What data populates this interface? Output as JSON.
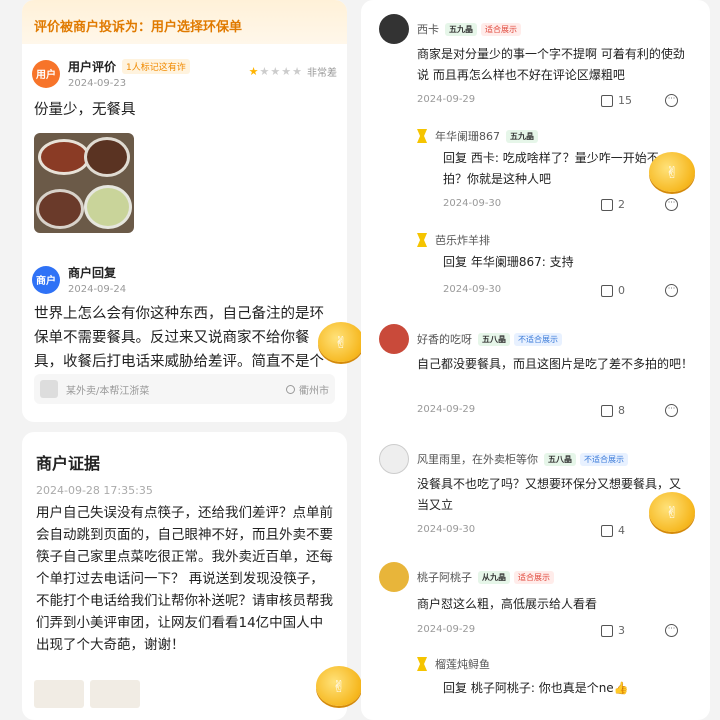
{
  "left": {
    "banner": "评价被商户投诉为：用户选择环保单",
    "review": {
      "avatar_text": "用户",
      "title": "用户评价",
      "tag": "1人标记这有诈",
      "date": "2024-09-23",
      "rating_label": "非常差",
      "stars": 1,
      "text": "份量少，无餐具"
    },
    "reply": {
      "avatar_text": "商户",
      "title": "商户回复",
      "date": "2024-09-24",
      "text": "世界上怎么会有你这种东西，自己备注的是环保单不需要餐具。反过来又说商家不给你餐具，收餐后打电话来威胁给差评。简直不是个人"
    },
    "shop": {
      "name": "某外卖/本帮江浙菜",
      "location": "衢州市"
    },
    "evidence": {
      "title": "商户证据",
      "timestamp": "2024-09-28 17:35:35",
      "text": "用户自己失误没有点筷子，还给我们差评？点单前会自动跳到页面的，自己眼神不好，而且外卖不要筷子自己家里点菜吃很正常。我外卖近百单，还每个单打过去电话问一下？ 再说送到发现没筷子，不能打个电话给我们让帮你补送呢？请审核员帮我们弄到小美评审团，让网友们看看14亿中国人中出现了个大奇葩，谢谢！"
    }
  },
  "comments": [
    {
      "name": "西卡",
      "level": "五九晶",
      "badge": "适合展示",
      "badge_kind": "r",
      "text": "商家是对分量少的事一个字不提啊 可着有利的使劲说 而且再怎么样也不好在评论区爆粗吧",
      "date": "2024-09-29",
      "likes": "15"
    },
    {
      "name": "年华阑珊867",
      "level": "五九晶",
      "badge": "",
      "badge_kind": "",
      "text": "回复  西卡: 吃成啥样了？量少咋一开始不拍？你就是这种人吧",
      "date": "2024-09-30",
      "likes": "2"
    },
    {
      "name": "芭乐炸羊排",
      "level": "",
      "badge": "",
      "badge_kind": "",
      "text": "回复  年华阑珊867: 支持",
      "date": "2024-09-30",
      "likes": "0"
    },
    {
      "name": "好香的吃呀",
      "level": "五八晶",
      "badge": "不适合展示",
      "badge_kind": "b",
      "text": "自己都没要餐具，而且这图片是吃了差不多拍的吧！",
      "date": "2024-09-29",
      "likes": "8"
    },
    {
      "name": "风里雨里，在外卖柜等你",
      "level": "五八晶",
      "badge": "不适合展示",
      "badge_kind": "b",
      "text": "没餐具不也吃了吗？又想要环保分又想要餐具，又当又立",
      "date": "2024-09-30",
      "likes": "4"
    },
    {
      "name": "桃子阿桃子",
      "level": "从九晶",
      "badge": "适合展示",
      "badge_kind": "r",
      "text": "商户怼这么粗，高低展示给人看看",
      "date": "2024-09-29",
      "likes": "3"
    },
    {
      "name": "榴莲炖鲟鱼",
      "level": "",
      "badge": "",
      "badge_kind": "",
      "text": "回复  桃子阿桃子: 你也真是个ne👍",
      "date": "",
      "likes": ""
    }
  ],
  "icons": {
    "thumb": "thumbs-up-icon",
    "more": "more-options-icon",
    "coin": "coin-sticker"
  }
}
